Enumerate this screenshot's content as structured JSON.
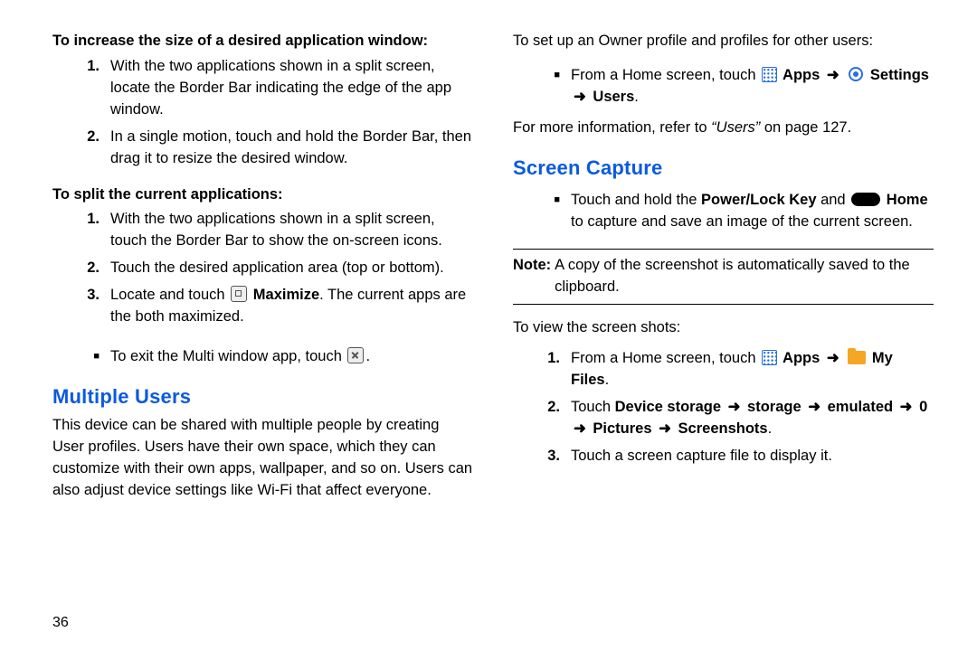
{
  "pageNumber": "36",
  "left": {
    "sub1_title": "To increase the size of a desired application window:",
    "sub1_items": [
      "With the two applications shown in a split screen, locate the Border Bar indicating the edge of the app window.",
      "In a single motion, touch and hold the Border Bar, then drag it to resize the desired window."
    ],
    "sub2_title": "To split the current applications:",
    "sub2_items": [
      "With the two applications shown in a split screen, touch the Border Bar to show the on-screen icons.",
      "Touch the desired application area (top or bottom)."
    ],
    "sub2_item3_pre": "Locate and touch ",
    "sub2_item3_bold": " Maximize",
    "sub2_item3_post": ". The current apps are the both maximized.",
    "exit_pre": "To exit the Multi window app, touch ",
    "exit_post": ".",
    "h_multiple": "Multiple Users",
    "multiple_para": "This device can be shared with multiple people by creating User profiles. Users have their own space, which they can customize with their own apps, wallpaper, and so on. Users can also adjust device settings like Wi-Fi that affect everyone."
  },
  "right": {
    "setup_intro": "To set up an Owner profile and profiles for other users:",
    "from_home": "From a Home screen, touch ",
    "apps_label": " Apps ",
    "settings_label": " Settings ",
    "users_label": " Users",
    "more_info_pre": "For more information, refer to ",
    "more_info_q": "“Users” ",
    "more_info_post": " on page 127.",
    "h_screen": "Screen Capture",
    "sc_pre": "Touch and hold the ",
    "sc_bold1": "Power/Lock Key",
    "sc_mid": " and ",
    "sc_bold2": " Home",
    "sc_post": " to capture and save an image of the current screen.",
    "note_label": "Note: ",
    "note_text": "A copy of the screenshot is automatically saved to the clipboard.",
    "view_intro": "To view the screen shots:",
    "v1_pre": "From a Home screen, touch ",
    "v1_apps": " Apps ",
    "v1_myfiles": " My Files",
    "v2_pre": "Touch ",
    "v2_b1": "Device storage ",
    "v2_b2": " storage ",
    "v2_b3": " emulated ",
    "v2_b4": " 0 ",
    "v2_b5": " Pictures ",
    "v2_b6": " Screenshots",
    "v3": "Touch a screen capture file to display it."
  },
  "arrows": {
    "r": "➜"
  }
}
